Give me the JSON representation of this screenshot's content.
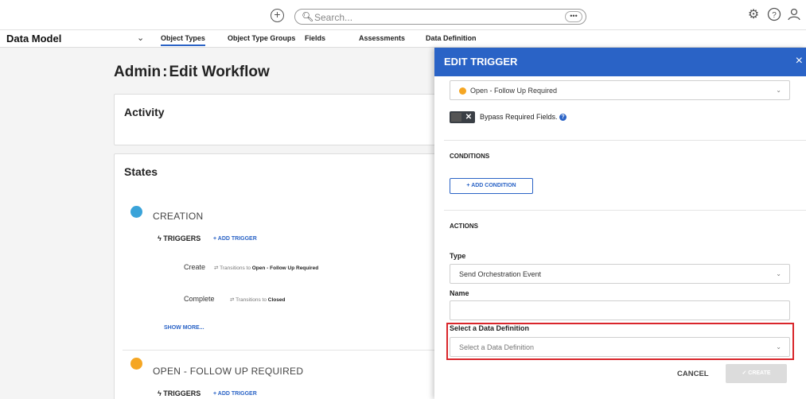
{
  "topbar": {
    "search_placeholder": "Search...",
    "dots": "•••",
    "icons": [
      "add-circle-icon",
      "search-icon",
      "more-icon",
      "gear-icon",
      "help-icon",
      "user-icon"
    ]
  },
  "nav": {
    "title": "Data Model",
    "chevron": "⌄",
    "tabs": [
      "Object Types",
      "Object Type Groups",
      "Fields",
      "Assessments",
      "Data Definition"
    ],
    "active_tab": "Object Types"
  },
  "page": {
    "title_prefix": "Admin",
    "title_sep": ":",
    "title_suffix": "Edit Workflow",
    "activity_title": "Activity",
    "states_title": "States",
    "states": [
      {
        "name": "CREATION",
        "color": "#3aa3d9",
        "triggers_label": "TRIGGERS",
        "add_trigger": "ADD TRIGGER",
        "rows": [
          {
            "label": "Create",
            "transition": "Transitions to",
            "target": "Open - Follow Up Required"
          },
          {
            "label": "Complete",
            "transition": "Transitions to",
            "target": "Closed"
          }
        ],
        "show_more": "SHOW MORE..."
      },
      {
        "name": "OPEN - FOLLOW UP REQUIRED",
        "color": "#f5a623",
        "triggers_label": "TRIGGERS",
        "add_trigger": "ADD TRIGGER"
      }
    ]
  },
  "panel": {
    "title": "EDIT TRIGGER",
    "close": "×",
    "state_select": "Open - Follow Up Required",
    "state_color": "#f5a623",
    "bypass_label": "Bypass Required Fields.",
    "conditions_label": "CONDITIONS",
    "add_condition": "ADD CONDITION",
    "actions_label": "ACTIONS",
    "type_label": "Type",
    "type_value": "Send Orchestration Event",
    "name_label": "Name",
    "name_value": "",
    "data_def_label": "Select a Data Definition",
    "data_def_placeholder": "Select a Data Definition",
    "cancel": "CANCEL",
    "create": "CREATE",
    "accent": "#2a63c6",
    "highlight_color": "#d9262b"
  }
}
